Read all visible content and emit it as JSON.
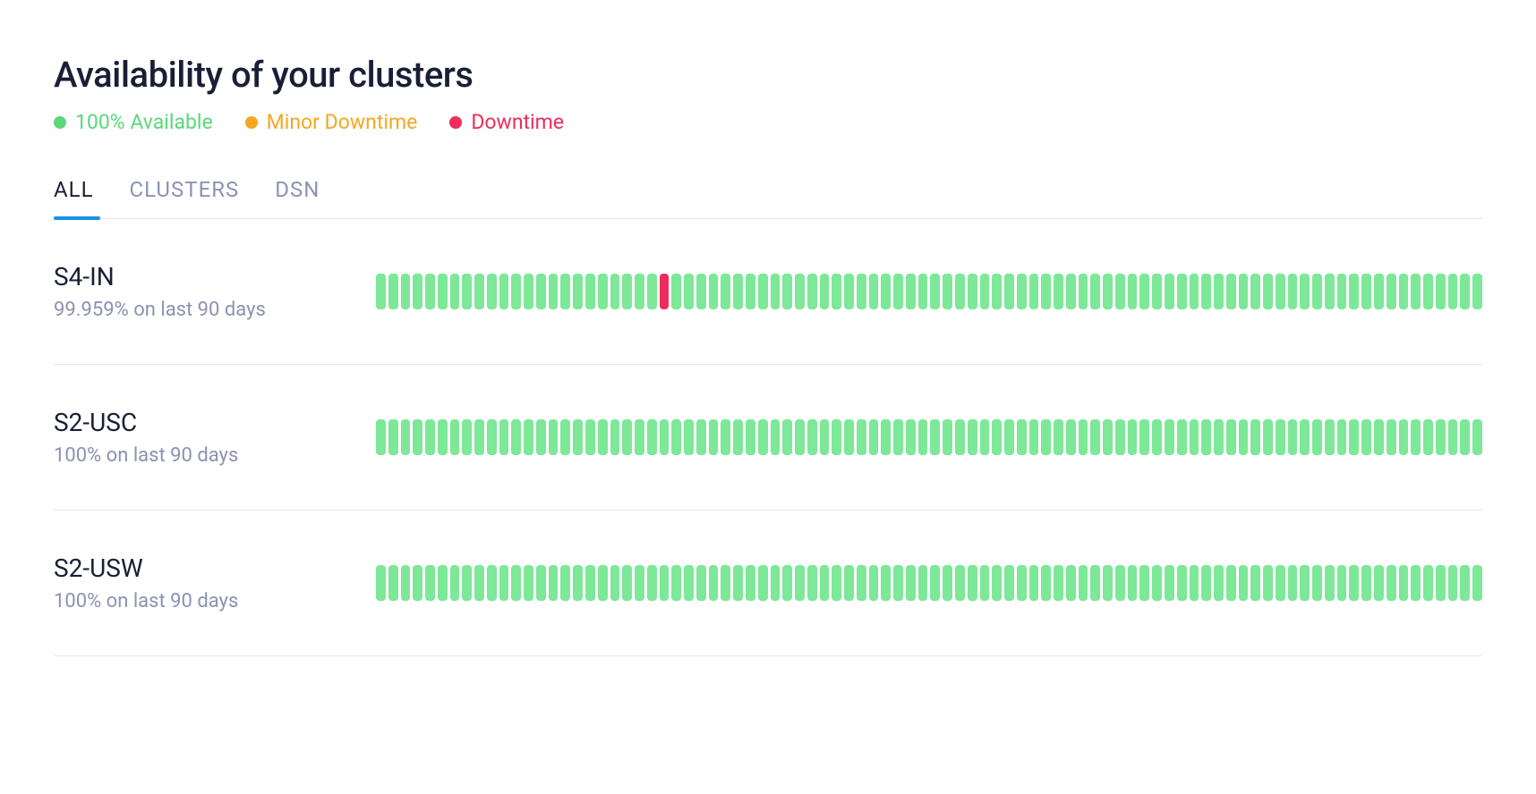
{
  "title": "Availability of your clusters",
  "legend": {
    "available": "100% Available",
    "minor": "Minor Downtime",
    "downtime": "Downtime"
  },
  "tabs": {
    "all": "ALL",
    "clusters": "CLUSTERS",
    "dsn": "DSN"
  },
  "clusters": [
    {
      "name": "S4-IN",
      "stat": "99.959% on last 90 days",
      "downtime_index": 23,
      "total_bars": 90
    },
    {
      "name": "S2-USC",
      "stat": "100% on last 90 days",
      "downtime_index": -1,
      "total_bars": 90
    },
    {
      "name": "S2-USW",
      "stat": "100% on last 90 days",
      "downtime_index": -1,
      "total_bars": 90
    }
  ]
}
